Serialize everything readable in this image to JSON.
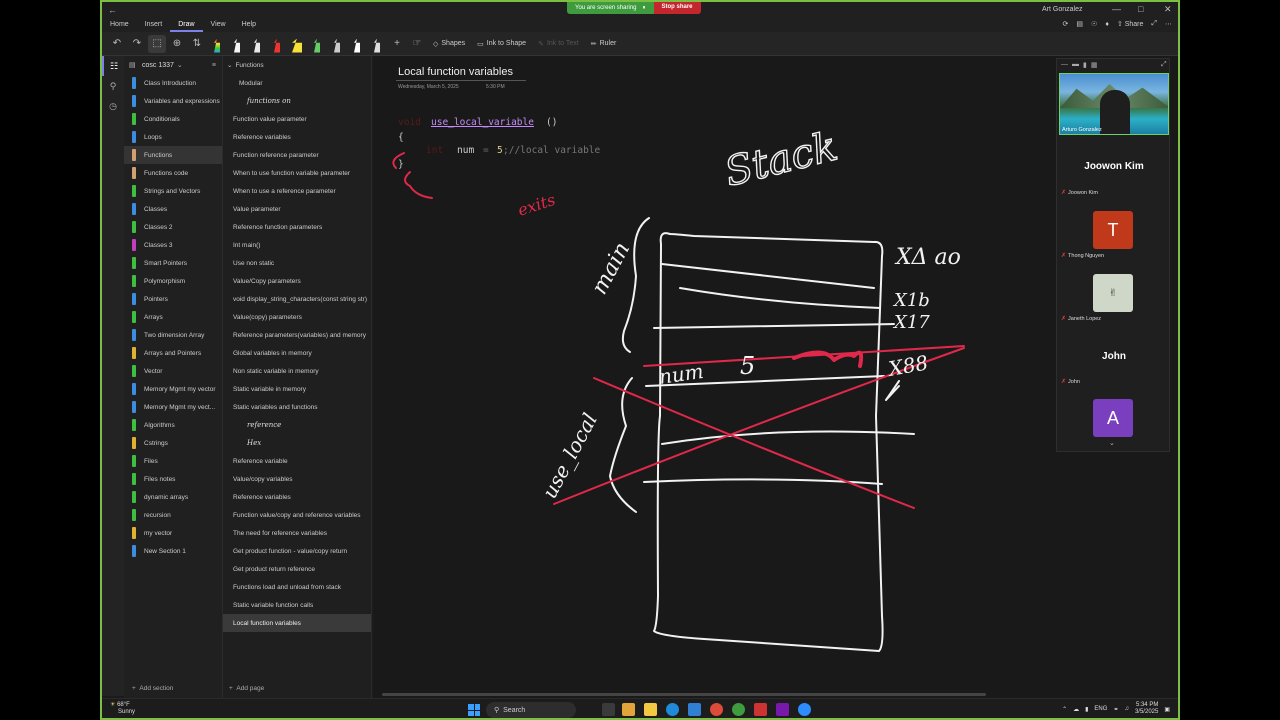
{
  "share": {
    "label": "You are screen sharing",
    "stop": "Stop share"
  },
  "titlebar": {
    "user": "Art Gonzalez"
  },
  "menu": [
    "Home",
    "Insert",
    "Draw",
    "View",
    "Help"
  ],
  "right_menu": {
    "share": "Share"
  },
  "toolbar": {
    "shapes": "Shapes",
    "ink_to_shape": "Ink to Shape",
    "ink_to_text": "Ink to Text",
    "ruler": "Ruler"
  },
  "notebook": {
    "name": "cosc 1337"
  },
  "sections": [
    {
      "label": "Class Introduction",
      "color": "#3b8de0"
    },
    {
      "label": "Variables and expressions",
      "color": "#3b8de0"
    },
    {
      "label": "Conditionals",
      "color": "#3fbf3f"
    },
    {
      "label": "Loops",
      "color": "#3b8de0"
    },
    {
      "label": "Functions",
      "color": "#d0a070"
    },
    {
      "label": "Functions code",
      "color": "#d0a070"
    },
    {
      "label": "Strings and Vectors",
      "color": "#3fbf3f"
    },
    {
      "label": "Classes",
      "color": "#3b8de0"
    },
    {
      "label": "Classes 2",
      "color": "#3fbf3f"
    },
    {
      "label": "Classes 3",
      "color": "#c03fbf"
    },
    {
      "label": "Smart Pointers",
      "color": "#3fbf3f"
    },
    {
      "label": "Polymorphism",
      "color": "#3fbf3f"
    },
    {
      "label": "Pointers",
      "color": "#3b8de0"
    },
    {
      "label": "Arrays",
      "color": "#3fbf3f"
    },
    {
      "label": "Two dimension Array",
      "color": "#3b8de0"
    },
    {
      "label": "Arrays and Pointers",
      "color": "#e0b030"
    },
    {
      "label": "Vector",
      "color": "#3fbf3f"
    },
    {
      "label": "Memory Mgmt my vector",
      "color": "#3b8de0"
    },
    {
      "label": "Memory Mgmt my vect...",
      "color": "#3b8de0"
    },
    {
      "label": "Algorithms",
      "color": "#3fbf3f"
    },
    {
      "label": "Cstrings",
      "color": "#e0b030"
    },
    {
      "label": "Files",
      "color": "#3fbf3f"
    },
    {
      "label": "Files notes",
      "color": "#3fbf3f"
    },
    {
      "label": "dynamic arrays",
      "color": "#3fbf3f"
    },
    {
      "label": "recursion",
      "color": "#3fbf3f"
    },
    {
      "label": "my vector",
      "color": "#e0b030"
    },
    {
      "label": "New Section 1",
      "color": "#3b8de0"
    }
  ],
  "add_section": "Add section",
  "pages": [
    {
      "label": "Functions",
      "type": "group"
    },
    {
      "label": "Modular",
      "type": "sub"
    },
    {
      "label": "functions on",
      "type": "hw"
    },
    {
      "label": "Function value parameter",
      "type": "page"
    },
    {
      "label": "Reference variables",
      "type": "page"
    },
    {
      "label": "Function reference parameter",
      "type": "page"
    },
    {
      "label": "When to use function variable parameter",
      "type": "page"
    },
    {
      "label": "When to use a reference parameter",
      "type": "page"
    },
    {
      "label": "Value parameter",
      "type": "page"
    },
    {
      "label": "Reference function parameters",
      "type": "page"
    },
    {
      "label": "Int main()",
      "type": "page"
    },
    {
      "label": "Use non static",
      "type": "page"
    },
    {
      "label": "Value/Copy parameters",
      "type": "page"
    },
    {
      "label": "void display_string_characters(const string str)",
      "type": "page"
    },
    {
      "label": "Value(copy) parameters",
      "type": "page"
    },
    {
      "label": "Reference parameters(variables) and memory",
      "type": "page"
    },
    {
      "label": "Global variables in memory",
      "type": "page"
    },
    {
      "label": "Non static variable in memory",
      "type": "page"
    },
    {
      "label": "Static variable in memory",
      "type": "page"
    },
    {
      "label": "Static variables and functions",
      "type": "page"
    },
    {
      "label": "reference",
      "type": "hw"
    },
    {
      "label": "Hex",
      "type": "hw"
    },
    {
      "label": "Reference variable",
      "type": "page"
    },
    {
      "label": "Value/copy variables",
      "type": "page"
    },
    {
      "label": "Reference variables",
      "type": "page"
    },
    {
      "label": "Function value/copy and reference variables",
      "type": "page"
    },
    {
      "label": "The need for reference variables",
      "type": "page"
    },
    {
      "label": "Get product function - value/copy return",
      "type": "page"
    },
    {
      "label": "Get product return reference",
      "type": "page"
    },
    {
      "label": "Functions load and unload from stack",
      "type": "page"
    },
    {
      "label": "Static variable function calls",
      "type": "page"
    },
    {
      "label": "Local function variables",
      "type": "page",
      "active": true
    }
  ],
  "add_page": "Add page",
  "page": {
    "title": "Local function variables",
    "date": "Wednesday, March 5, 2025",
    "time": "5:30 PM",
    "code": {
      "line1_type": "void",
      "line1_func": "use_local_variable",
      "line1_parens": "()",
      "line2": "{",
      "line3_type": "int",
      "line3_var": "num",
      "line3_eq": "=",
      "line3_val": "5",
      "line3_comment": ";//local variable",
      "line4": "}"
    },
    "ink": {
      "stack": "Stack",
      "main": "main",
      "use_local": "use_local",
      "exits": "exits",
      "num": "num",
      "five": "5",
      "addr_top": "XΔ ao",
      "addr_2": "X1b",
      "addr_3": "X17",
      "addr_num": "X88"
    }
  },
  "zoom": {
    "host_name": "Arturo Gonzalez",
    "participants": [
      {
        "big": "Joowon Kim",
        "small": "Joowon Kim"
      },
      {
        "initial": "T",
        "small": "Thong Nguyen",
        "color": "#c0391b"
      },
      {
        "small": "Janeth Lopez"
      },
      {
        "big": "John",
        "small": "John"
      },
      {
        "initial": "A",
        "color": "#7a3fbf"
      }
    ]
  },
  "taskbar": {
    "temp": "68°F",
    "weather": "Sunny",
    "search": "Search",
    "lang": "ENG",
    "time": "5:34 PM",
    "date": "3/5/2025"
  }
}
